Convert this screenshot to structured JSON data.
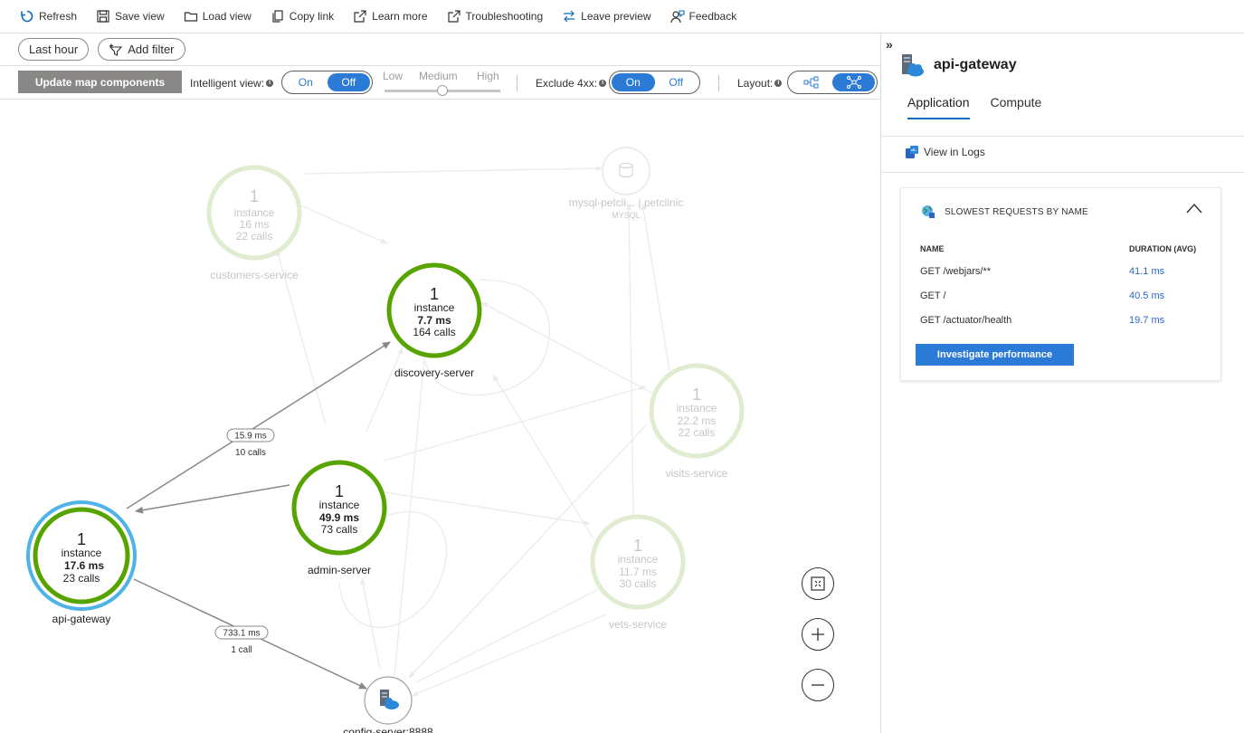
{
  "toolbar": {
    "refresh": "Refresh",
    "save_view": "Save view",
    "load_view": "Load view",
    "copy_link": "Copy link",
    "learn_more": "Learn more",
    "troubleshooting": "Troubleshooting",
    "leave_preview": "Leave preview",
    "feedback": "Feedback"
  },
  "filters": {
    "time": "Last hour",
    "add_filter": "Add filter"
  },
  "controls": {
    "update_button": "Update map components",
    "intelligent_view_label": "Intelligent view:",
    "intelligent_on": "On",
    "intelligent_off": "Off",
    "intelligent_selected": "Off",
    "slider_low": "Low",
    "slider_medium": "Medium",
    "slider_high": "High",
    "exclude_label": "Exclude 4xx:",
    "exclude_on": "On",
    "exclude_off": "Off",
    "exclude_selected": "On",
    "layout_label": "Layout:"
  },
  "map": {
    "nodes": {
      "customers": {
        "count": "1",
        "unit": "instance",
        "duration": "16 ms",
        "calls": "22 calls",
        "name": "customers-service"
      },
      "discovery": {
        "count": "1",
        "unit": "instance",
        "duration": "7.7 ms",
        "calls": "164 calls",
        "name": "discovery-server"
      },
      "mysql": {
        "name": "mysql-petcli... | petclinic",
        "type": "MYSQL"
      },
      "visits": {
        "count": "1",
        "unit": "instance",
        "duration": "22.2 ms",
        "calls": "22 calls",
        "name": "visits-service"
      },
      "admin": {
        "count": "1",
        "unit": "instance",
        "duration": "49.9 ms",
        "calls": "73 calls",
        "name": "admin-server"
      },
      "gateway": {
        "count": "1",
        "unit": "instance",
        "duration": "17.6 ms",
        "calls": "23 calls",
        "name": "api-gateway"
      },
      "vets": {
        "count": "1",
        "unit": "instance",
        "duration": "11.7 ms",
        "calls": "30 calls",
        "name": "vets-service"
      },
      "config": {
        "name": "config-server:8888",
        "type": "HTTP"
      }
    },
    "edges": {
      "gw_discovery": {
        "duration": "15.9 ms",
        "calls": "10 calls"
      },
      "gw_config": {
        "duration": "733.1 ms",
        "calls": "1 call"
      }
    }
  },
  "panel": {
    "title": "api-gateway",
    "tabs": [
      "Application",
      "Compute"
    ],
    "view_in_logs": "View in Logs",
    "card": {
      "title": "SLOWEST REQUESTS BY NAME",
      "col_name": "NAME",
      "col_duration": "DURATION (AVG)",
      "rows": [
        {
          "name": "GET /webjars/**",
          "duration": "41.1 ms"
        },
        {
          "name": "GET /",
          "duration": "40.5 ms"
        },
        {
          "name": "GET /actuator/health",
          "duration": "19.7 ms"
        }
      ],
      "button": "Investigate performance"
    }
  },
  "colors": {
    "healthy": "#57a300",
    "faded": "#dfecd0",
    "selected_ring": "#4fb3e8",
    "accent": "#2b7bd6"
  }
}
